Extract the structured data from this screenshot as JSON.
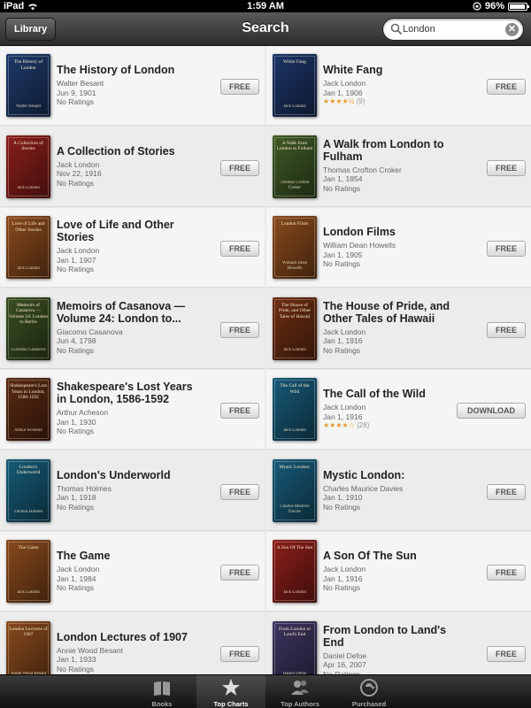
{
  "status": {
    "device": "iPad",
    "time": "1:59 AM",
    "battery": "96%",
    "battery_level": 0.96
  },
  "nav": {
    "library_label": "Library",
    "title": "Search"
  },
  "search": {
    "value": "London",
    "placeholder": ""
  },
  "books": [
    {
      "title": "The History of London",
      "author": "Walter Besant",
      "date": "Jun 9, 1901",
      "rating": "No Ratings",
      "button": "FREE",
      "cover_title": "The History of London",
      "cover_author": "Walter Besant",
      "cover_color": "#1f3a6b"
    },
    {
      "title": "White Fang",
      "author": "Jack London",
      "date": "Jan 1, 1906",
      "stars": "★★★★½",
      "rating_count": "(9)",
      "button": "FREE",
      "cover_title": "White Fang",
      "cover_author": "Jack London",
      "cover_color": "#1c3566"
    },
    {
      "title": "A Collection of Stories",
      "author": "Jack London",
      "date": "Nov 22, 1916",
      "rating": "No Ratings",
      "button": "FREE",
      "cover_title": "A Collection of Stories",
      "cover_author": "Jack London",
      "cover_color": "#8c1f1a"
    },
    {
      "title": "A Walk from London to Fulham",
      "author": "Thomas Crofton Croker",
      "date": "Jan 1, 1854",
      "rating": "No Ratings",
      "button": "FREE",
      "cover_title": "A Walk from London to Fulham",
      "cover_author": "Thomas Crofton Croker",
      "cover_color": "#3f5a26"
    },
    {
      "title": "Love of Life and Other Stories",
      "author": "Jack London",
      "date": "Jan 1, 1907",
      "rating": "No Ratings",
      "button": "FREE",
      "cover_title": "Love of Life and Other Stories",
      "cover_author": "Jack London",
      "cover_color": "#8a4a1c"
    },
    {
      "title": "London Films",
      "author": "William Dean Howells",
      "date": "Jan 1, 1905",
      "rating": "No Ratings",
      "button": "FREE",
      "cover_title": "London Films",
      "cover_author": "William Dean Howells",
      "cover_color": "#8a4a1c"
    },
    {
      "title": "Memoirs of Casanova — Volume 24: London to...",
      "author": "Giacomo Casanova",
      "date": "Jun 4, 1798",
      "rating": "No Ratings",
      "button": "FREE",
      "cover_title": "Memoirs of Casanova — Volume 24: London to Berlin",
      "cover_author": "Giacomo Casanova",
      "cover_color": "#3b4f22"
    },
    {
      "title": "The House of Pride, and Other Tales of Hawaii",
      "author": "Jack London",
      "date": "Jan 1, 1916",
      "rating": "No Ratings",
      "button": "FREE",
      "cover_title": "The House of Pride, and Other Tales of Hawaii",
      "cover_author": "Jack London",
      "cover_color": "#6e2e12"
    },
    {
      "title": "Shakespeare's Lost Years in London, 1586-1592",
      "author": "Arthur Acheson",
      "date": "Jan 1, 1930",
      "rating": "No Ratings",
      "button": "FREE",
      "cover_title": "Shakespeare's Lost Years in London, 1586-1592",
      "cover_author": "Arthur Acheson",
      "cover_color": "#5a2a12"
    },
    {
      "title": "The Call of the Wild",
      "author": "Jack London",
      "date": "Jan 1, 1916",
      "stars": "★★★★☆",
      "rating_count": "(28)",
      "button": "DOWNLOAD",
      "cover_title": "The Call of the Wild",
      "cover_author": "Jack London",
      "cover_color": "#175a78"
    },
    {
      "title": "London's Underworld",
      "author": "Thomas Holmes",
      "date": "Jan 1, 1918",
      "rating": "No Ratings",
      "button": "FREE",
      "cover_title": "London's Underworld",
      "cover_author": "Thomas Holmes",
      "cover_color": "#165c78"
    },
    {
      "title": "Mystic London:",
      "author": "Charles Maurice Davies",
      "date": "Jan 1, 1910",
      "rating": "No Ratings",
      "button": "FREE",
      "cover_title": "Mystic London:",
      "cover_author": "Charles Maurice Davies",
      "cover_color": "#175a78"
    },
    {
      "title": "The Game",
      "author": "Jack London",
      "date": "Jan 1, 1984",
      "rating": "No Ratings",
      "button": "FREE",
      "cover_title": "The Game",
      "cover_author": "Jack London",
      "cover_color": "#8a4a1c"
    },
    {
      "title": "A Son Of The Sun",
      "author": "Jack London",
      "date": "Jan 1, 1916",
      "rating": "No Ratings",
      "button": "FREE",
      "cover_title": "A Son Of The Sun",
      "cover_author": "Jack London",
      "cover_color": "#8c1f1a"
    },
    {
      "title": "London Lectures of 1907",
      "author": "Annie Wood Besant",
      "date": "Jan 1, 1933",
      "rating": "No Ratings",
      "button": "FREE",
      "cover_title": "London Lectures of 1907",
      "cover_author": "Annie Wood Besant",
      "cover_color": "#8a4a1c"
    },
    {
      "title": "From London to Land's End",
      "author": "Daniel Defoe",
      "date": "Apr 16, 2007",
      "rating": "No Ratings",
      "button": "FREE",
      "cover_title": "From London to Land's End",
      "cover_author": "Daniel Defoe",
      "cover_color": "#3d3560"
    }
  ],
  "tabs": [
    {
      "label": "Books",
      "icon": "books-icon"
    },
    {
      "label": "Top Charts",
      "icon": "star-icon",
      "active": true
    },
    {
      "label": "Top Authors",
      "icon": "authors-icon"
    },
    {
      "label": "Purchased",
      "icon": "purchased-icon"
    }
  ]
}
